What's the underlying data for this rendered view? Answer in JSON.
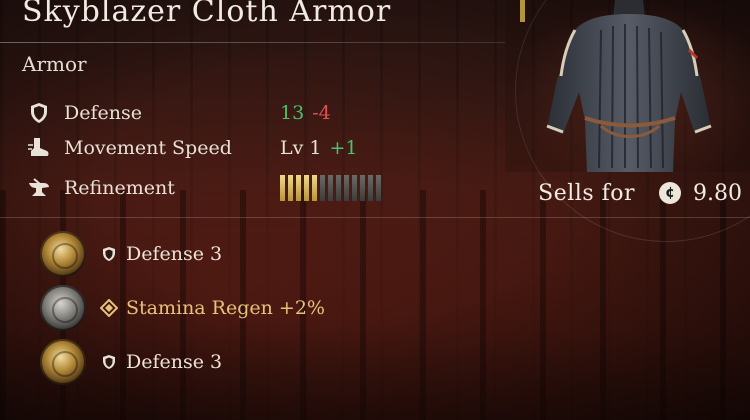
{
  "item": {
    "name": "Skyblazer Cloth Armor",
    "category": "Armor"
  },
  "stats": [
    {
      "label": "Defense",
      "icon": "shield-icon",
      "value": "13",
      "delta": "-4",
      "delta_color": "#e35050"
    },
    {
      "label": "Movement Speed",
      "icon": "boot-icon",
      "prefix": "Lv 1",
      "delta": "+1",
      "delta_color": "#4cc06a"
    },
    {
      "label": "Refinement",
      "icon": "anvil-icon",
      "refinement": {
        "filled": 5,
        "total": 13
      }
    }
  ],
  "stat_value_color": "#4cc06a",
  "sell": {
    "label": "Sells for",
    "currency_icon": "coin-icon",
    "value": "9.80"
  },
  "perks": [
    {
      "gem": "gold-gem-icon",
      "icon": "shield-icon",
      "text": "Defense 3"
    },
    {
      "gem": "silver-gem-icon",
      "icon": "diamond-icon",
      "text": "Stamina Regen +2%",
      "color": "#e8c27a"
    },
    {
      "gem": "gold-gem-icon",
      "icon": "shield-icon",
      "text": "Defense 3"
    }
  ]
}
